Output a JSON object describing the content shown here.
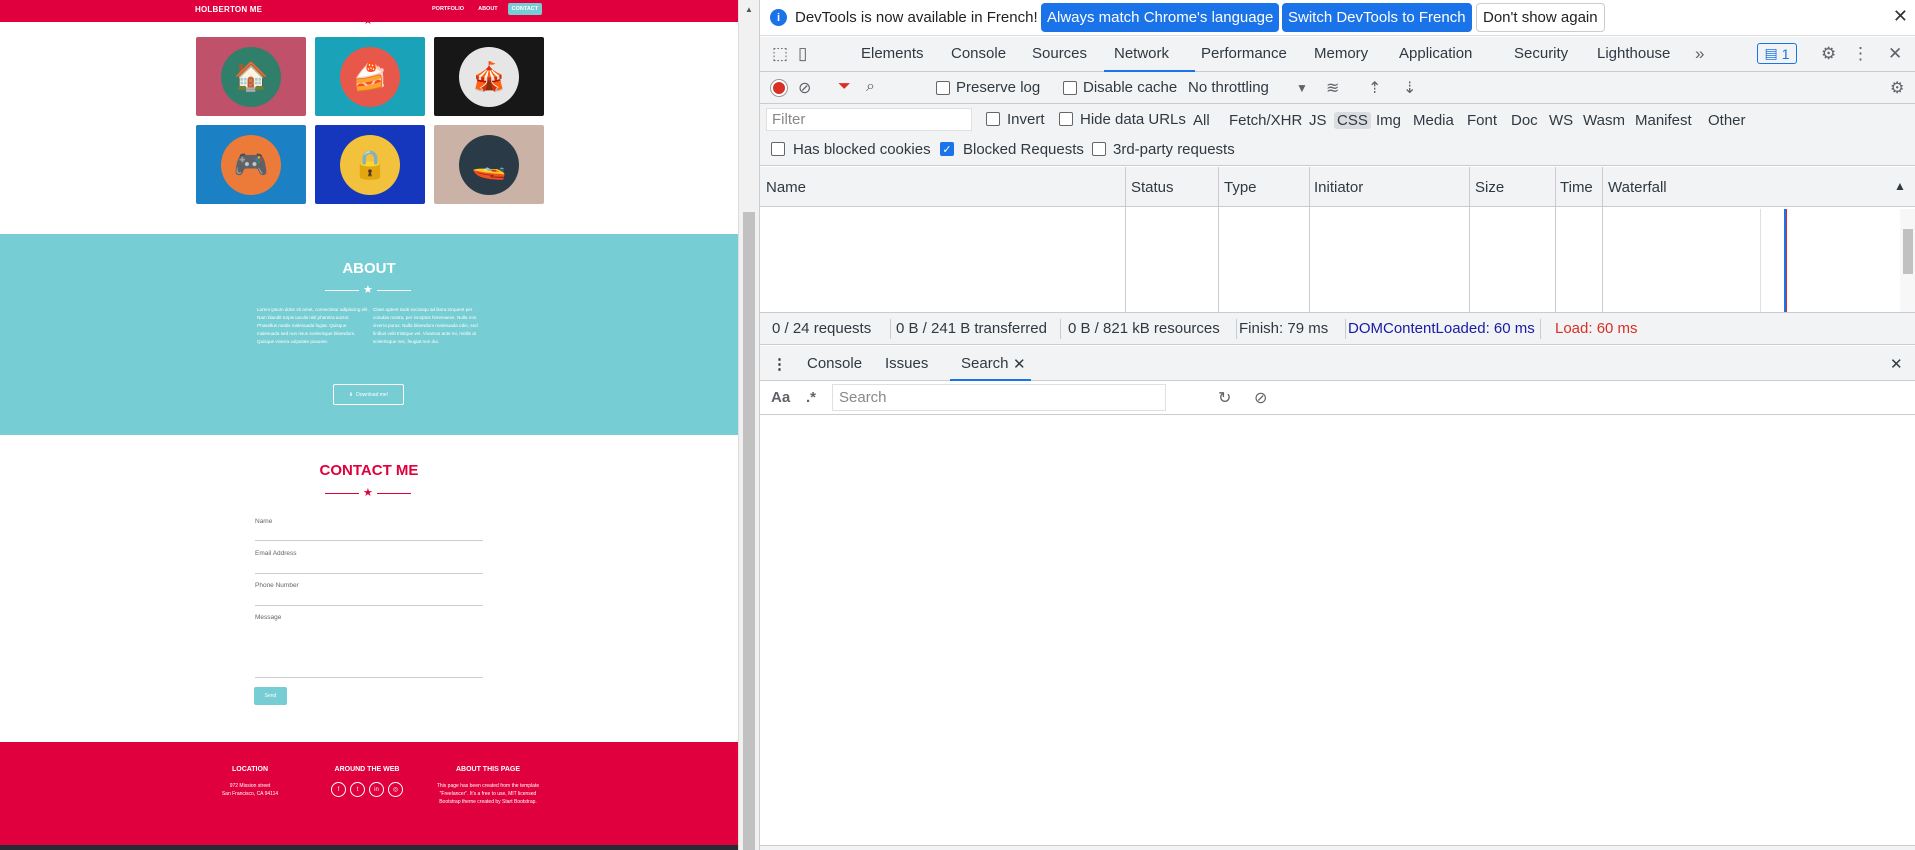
{
  "website": {
    "brand": "HOLBERTON ME",
    "nav": [
      "PORTFOLIO",
      "ABOUT",
      "CONTACT"
    ],
    "nav_active": "CONTACT",
    "portfolio": [
      {
        "icon": "cabin-icon",
        "bg": "#c0516a",
        "circle": "#2f7f6a",
        "glyph": "🏠"
      },
      {
        "icon": "cake-icon",
        "bg": "#1aa3b8",
        "circle": "#e8584a",
        "glyph": "🍰"
      },
      {
        "icon": "circus-tent-icon",
        "bg": "#171717",
        "circle": "#e6e6e6",
        "glyph": "🎪"
      },
      {
        "icon": "game-controller-icon",
        "bg": "#1b80c4",
        "circle": "#ec7b3a",
        "glyph": "🎮"
      },
      {
        "icon": "safe-icon",
        "bg": "#1537bd",
        "circle": "#f2c23d",
        "glyph": "🔒"
      },
      {
        "icon": "submarine-icon",
        "bg": "#cab3a6",
        "circle": "#2a3b47",
        "glyph": "🚤"
      }
    ],
    "about": {
      "title": "ABOUT",
      "col1": "Lorem ipsum dolor sit amet, consectetur adipiscing elit. Nam blandit turpis iaculis nisl pharetra auctor. Phasellus mattis malesuada fugiat. Quisque malesuada sed non risus scelerisque bibendum. Quisque viverra vulputate posuere.",
      "col2": "Class aptent taciti sociosqu ad litora torquent per conubia nostra, per inceptos himenaeos. Nulla non viverra purus. Nulla bibendum malesuada odio, sed finibus velit tristique vel. Vivamus ante mi, mollis at scelerisque nec, feugiat non dui.",
      "download_label": "Download me!"
    },
    "contact": {
      "title": "CONTACT ME",
      "name_placeholder": "Name",
      "email_placeholder": "Email Address",
      "phone_placeholder": "Phone Number",
      "message_placeholder": "Message",
      "send_label": "Send"
    },
    "footer": {
      "location_title": "LOCATION",
      "location_line1": "972 Mission street",
      "location_line2": "San Francisco, CA 94114",
      "around_title": "AROUND THE WEB",
      "socials": [
        "facebook-icon",
        "twitter-icon",
        "linkedin-icon",
        "dribbble-icon"
      ],
      "about_title": "ABOUT THIS PAGE",
      "about_text": "This page has been created from the template \"Freelancer\". It's a free to use, MIT licensed Bootstrap theme created by Start Bootstrap."
    }
  },
  "devtools": {
    "info_text": "DevTools is now available in French!",
    "btn_match": "Always match Chrome's language",
    "btn_switch": "Switch DevTools to French",
    "btn_dont_show": "Don't show again",
    "tabs": [
      "Elements",
      "Console",
      "Sources",
      "Network",
      "Performance",
      "Memory",
      "Application",
      "Security",
      "Lighthouse"
    ],
    "active_tab": "Network",
    "issues_count": "1",
    "preserve_log": "Preserve log",
    "disable_cache": "Disable cache",
    "throttling": "No throttling",
    "filter_placeholder": "Filter",
    "invert": "Invert",
    "hide_data_urls": "Hide data URLs",
    "types": [
      "All",
      "Fetch/XHR",
      "JS",
      "CSS",
      "Img",
      "Media",
      "Font",
      "Doc",
      "WS",
      "Wasm",
      "Manifest",
      "Other"
    ],
    "type_selected": "CSS",
    "has_blocked_cookies": "Has blocked cookies",
    "blocked_requests": "Blocked Requests",
    "third_party": "3rd-party requests",
    "columns": [
      "Name",
      "Status",
      "Type",
      "Initiator",
      "Size",
      "Time",
      "Waterfall"
    ],
    "summary": {
      "requests": "0 / 24 requests",
      "transferred": "0 B / 241 B transferred",
      "resources": "0 B / 821 kB resources",
      "finish": "Finish: 79 ms",
      "dcl": "DOMContentLoaded: 60 ms",
      "load": "Load: 60 ms"
    },
    "drawer_tabs": [
      "Console",
      "Issues",
      "Search"
    ],
    "drawer_active": "Search",
    "search_placeholder": "Search",
    "case_label": "Aa",
    "regex_label": ".*",
    "colors": {
      "accent": "#1a73e8",
      "dcl": "#1a1aa6",
      "load": "#d93025",
      "site_red": "#e0003e",
      "site_teal": "#77cdd4"
    }
  }
}
